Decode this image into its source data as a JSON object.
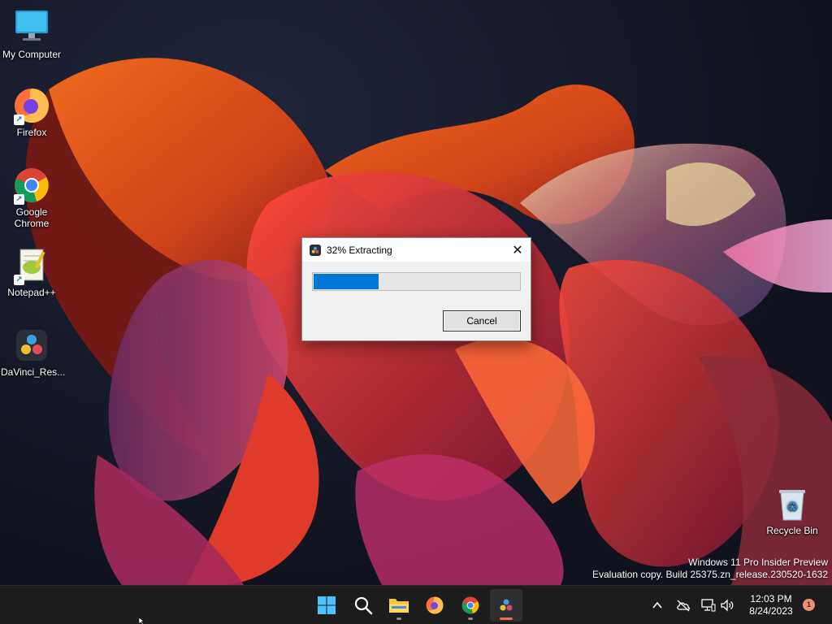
{
  "desktop": {
    "icons": [
      {
        "label": "My Computer",
        "icon": "monitor-icon"
      },
      {
        "label": "Firefox",
        "icon": "firefox-icon"
      },
      {
        "label": "Google Chrome",
        "icon": "chrome-icon"
      },
      {
        "label": "Notepad++",
        "icon": "notepadpp-icon"
      },
      {
        "label": "DaVinci_Res...",
        "icon": "davinci-resolve-icon"
      },
      {
        "label": "Recycle Bin",
        "icon": "recycle-bin-icon"
      }
    ]
  },
  "dialog": {
    "title": "32% Extracting",
    "progress_percent": 32,
    "cancel_label": "Cancel",
    "close_glyph": "✕"
  },
  "watermark": {
    "line1": "Windows 11 Pro Insider Preview",
    "line2": "Evaluation copy. Build 25375.zn_release.230520-1632"
  },
  "taskbar": {
    "apps": [
      "start-icon",
      "search-icon",
      "file-explorer-icon",
      "firefox-icon",
      "chrome-icon",
      "davinci-resolve-icon"
    ],
    "active_app": "davinci-resolve-icon",
    "tray": [
      "chevron-up-icon",
      "cloud-offline-icon",
      "network-icon",
      "volume-icon"
    ],
    "time": "12:03 PM",
    "date": "8/24/2023",
    "notification_count": "1"
  },
  "colors": {
    "accent": "#0078d7",
    "taskbar": "#1c1c1c",
    "active_indicator": "#f26b4a"
  }
}
